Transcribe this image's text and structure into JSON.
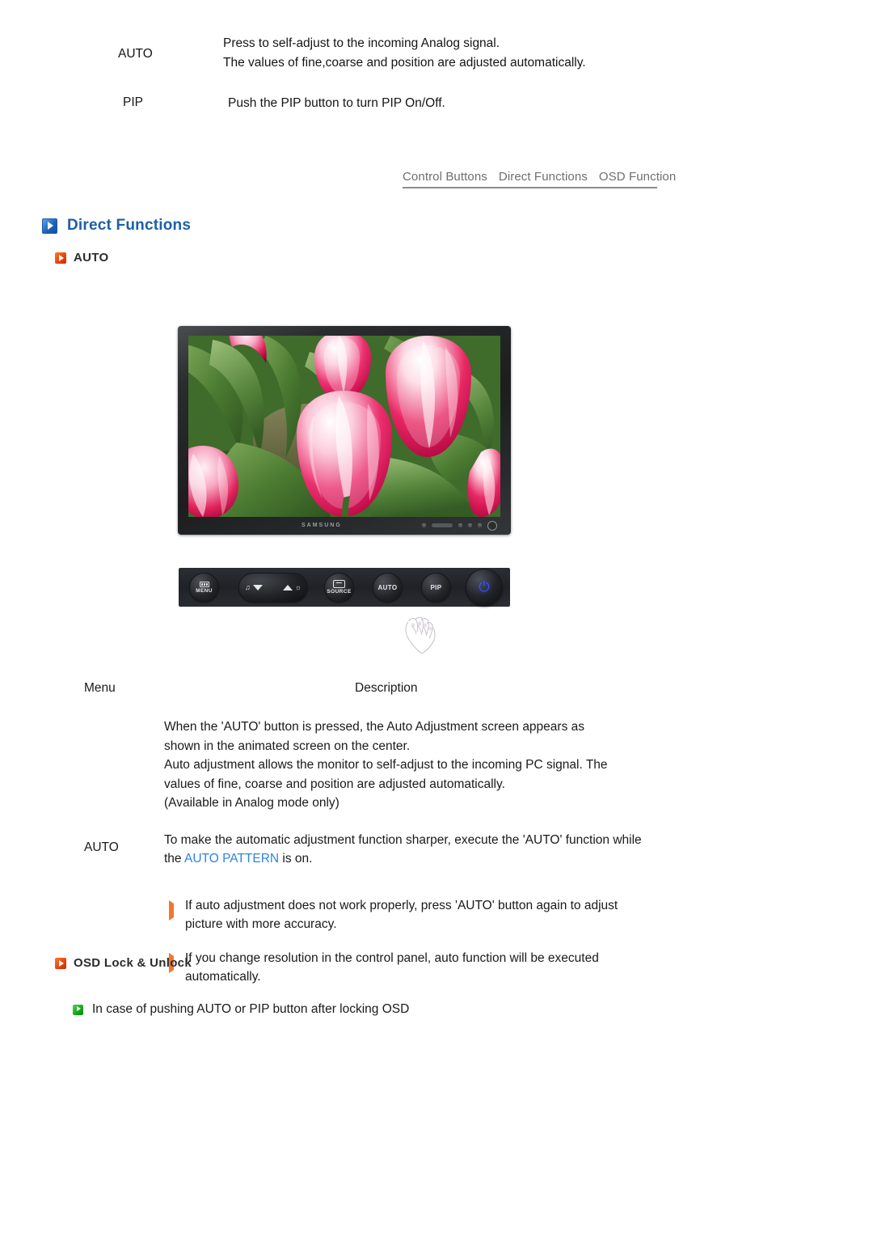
{
  "top_table": {
    "rows": [
      {
        "key": "AUTO",
        "lines": [
          "Press to self-adjust to the incoming Analog signal.",
          "The values of fine,coarse and position are adjusted automatically."
        ]
      },
      {
        "key": "PIP",
        "lines": [
          "Push the PIP button to turn PIP On/Off."
        ]
      }
    ]
  },
  "tabs": [
    {
      "label": "Control Buttons"
    },
    {
      "label": "Direct Functions"
    },
    {
      "label": "OSD Function"
    }
  ],
  "section": {
    "title": "Direct Functions",
    "icon": "blue-play-icon",
    "accent_color": "#1c5fa8"
  },
  "subsections": {
    "auto": {
      "title": "AUTO",
      "icon": "orange-play-icon",
      "accent_color": "#e8400d"
    },
    "osd_lock": {
      "title": "OSD Lock & Unlock",
      "icon": "orange-play-icon",
      "accent_color": "#e8400d"
    }
  },
  "monitor": {
    "brand": "SAMSUNG",
    "screen_alt": "photo of pink and white tulips"
  },
  "control_bar": {
    "buttons": [
      {
        "name": "menu-button",
        "label": "MENU",
        "icon": "menu-bars-icon"
      },
      {
        "name": "down-button",
        "label": "",
        "icon": "triangle-down-icon"
      },
      {
        "name": "up-button",
        "label": "",
        "icon": "triangle-up-icon"
      },
      {
        "name": "source-button",
        "label": "SOURCE",
        "icon": "source-icon"
      },
      {
        "name": "auto-button",
        "label": "AUTO",
        "icon": ""
      },
      {
        "name": "pip-button",
        "label": "PIP",
        "icon": ""
      },
      {
        "name": "power-button",
        "label": "",
        "icon": "power-icon"
      }
    ]
  },
  "desc_table": {
    "header": {
      "menu": "Menu",
      "description": "Description"
    },
    "menu_label": "AUTO",
    "paragraphs": [
      "When the 'AUTO' button is pressed, the Auto Adjustment screen appears as shown in the animated screen on the center. Auto adjustment allows the monitor to self-adjust to the incoming PC signal. The values of fine, coarse and position are adjusted automatically. (Available in Analog mode only)"
    ],
    "para_lines": [
      "When the 'AUTO' button is pressed, the Auto Adjustment screen appears as",
      "shown in the animated screen on the center.",
      "Auto adjustment allows the monitor to self-adjust to the incoming PC signal. The",
      "values of fine, coarse and position are adjusted automatically.",
      "(Available in Analog mode only)"
    ],
    "sharper_prefix": "To make the automatic adjustment function sharper, execute the 'AUTO' function while the ",
    "sharper_link": "AUTO PATTERN",
    "sharper_suffix": " is on.",
    "bullets": [
      "If auto adjustment does not work properly, press 'AUTO' button again to adjust picture with more accuracy.",
      "If you change resolution in the control panel, auto function will be executed automatically."
    ]
  },
  "osd_note": {
    "text": "In case of pushing AUTO or PIP button after locking OSD",
    "icon": "green-play-icon"
  }
}
